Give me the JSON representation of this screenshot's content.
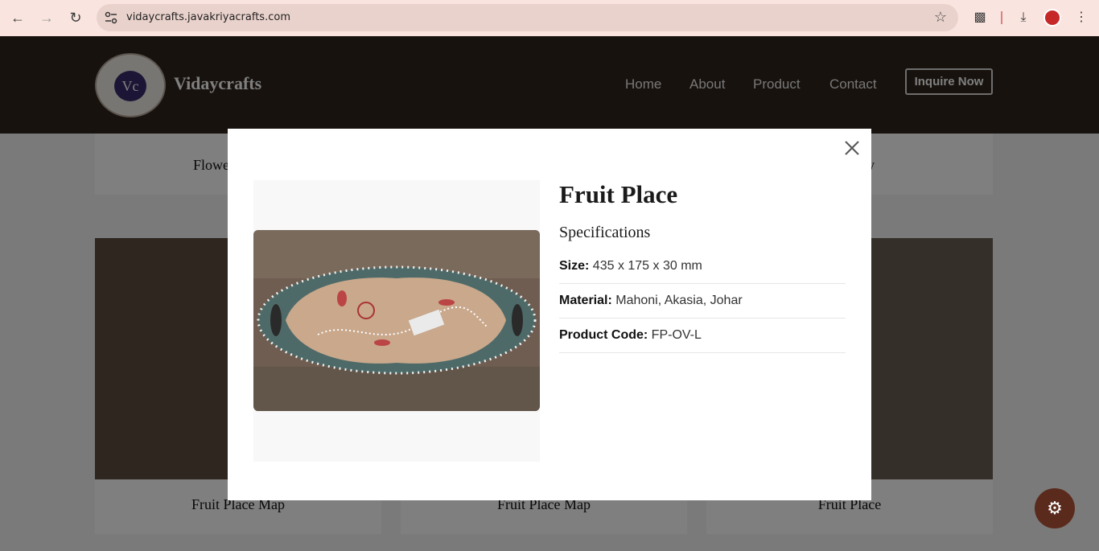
{
  "browser": {
    "url": "vidaycrafts.javakriyacrafts.com"
  },
  "site": {
    "brand": "Vidaycrafts",
    "logo_text": "VIDAYCRAFTS",
    "logo_mark": "Vc",
    "nav": [
      "Home",
      "About",
      "Product",
      "Contact"
    ],
    "cta": "Inquire Now"
  },
  "cards": {
    "top_left_caption": "Flowe",
    "top_right_caption": "y",
    "bottom": [
      "Fruit Place Map",
      "Fruit Place Map",
      "Fruit Place"
    ]
  },
  "modal": {
    "title": "Fruit Place",
    "spec_heading": "Specifications",
    "specs": [
      {
        "key": "Size:",
        "value": "435 x 175 x 30 mm"
      },
      {
        "key": "Material:",
        "value": "Mahoni, Akasia, Johar"
      },
      {
        "key": "Product Code:",
        "value": "FP-OV-L"
      }
    ]
  },
  "colors": {
    "header_bg": "#2e241c",
    "accent": "#5a2a1c",
    "chrome_bg": "#f9e4df"
  }
}
